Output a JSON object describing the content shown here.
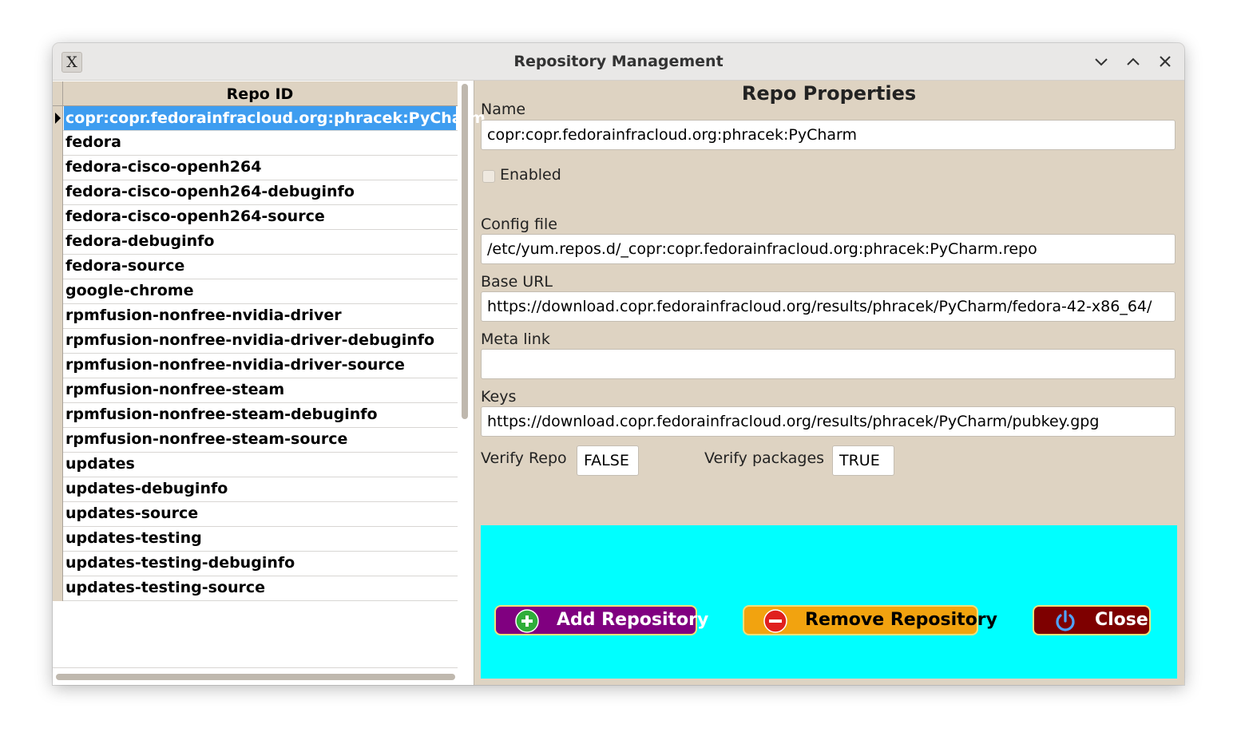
{
  "window": {
    "title": "Repository Management",
    "app_icon": "X"
  },
  "repo_list": {
    "header": "Repo ID",
    "selected_index": 0,
    "items": [
      "copr:copr.fedorainfracloud.org:phracek:PyCharm",
      "fedora",
      "fedora-cisco-openh264",
      "fedora-cisco-openh264-debuginfo",
      "fedora-cisco-openh264-source",
      "fedora-debuginfo",
      "fedora-source",
      "google-chrome",
      "rpmfusion-nonfree-nvidia-driver",
      "rpmfusion-nonfree-nvidia-driver-debuginfo",
      "rpmfusion-nonfree-nvidia-driver-source",
      "rpmfusion-nonfree-steam",
      "rpmfusion-nonfree-steam-debuginfo",
      "rpmfusion-nonfree-steam-source",
      "updates",
      "updates-debuginfo",
      "updates-source",
      "updates-testing",
      "updates-testing-debuginfo",
      "updates-testing-source"
    ]
  },
  "properties": {
    "title": "Repo Properties",
    "name_label": "Name",
    "name_value": "copr:copr.fedorainfracloud.org:phracek:PyCharm",
    "enabled_label": "Enabled",
    "enabled_checked": false,
    "config_label": "Config file",
    "config_value": "/etc/yum.repos.d/_copr:copr.fedorainfracloud.org:phracek:PyCharm.repo",
    "baseurl_label": "Base URL",
    "baseurl_value": "https://download.copr.fedorainfracloud.org/results/phracek/PyCharm/fedora-42-x86_64/",
    "metalink_label": "Meta link",
    "metalink_value": "",
    "keys_label": "Keys",
    "keys_value": "https://download.copr.fedorainfracloud.org/results/phracek/PyCharm/pubkey.gpg",
    "verify_repo_label": "Verify Repo",
    "verify_repo_value": "FALSE",
    "verify_packages_label": "Verify packages",
    "verify_packages_value": "TRUE"
  },
  "buttons": {
    "add_label": "Add Repository",
    "remove_label": "Remove Repository",
    "close_label": "Close"
  },
  "colors": {
    "window_bg": "#ded3c2",
    "selection": "#3e9df0",
    "info_box": "#00ffff",
    "add_button": "#800080",
    "remove_button": "#f2a30f",
    "close_button": "#7e0000"
  },
  "icons": {
    "app": "x-app-icon",
    "minimize": "chevron-down-icon",
    "maximize": "chevron-up-icon",
    "close": "close-x-icon",
    "add": "plus-circle-icon",
    "remove": "minus-circle-icon",
    "close_button": "power-icon"
  }
}
